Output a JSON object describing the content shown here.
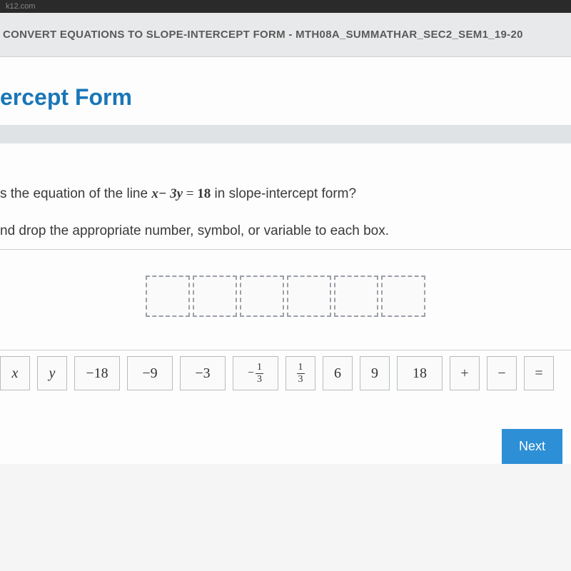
{
  "browser": {
    "url_fragment": "k12.com"
  },
  "header": {
    "breadcrumb": "CONVERT EQUATIONS TO SLOPE-INTERCEPT FORM - MTH08A_SUMMATHAR_SEC2_SEM1_19-20"
  },
  "page": {
    "title_fragment": "ercept Form",
    "question_prefix": "s the equation of the line ",
    "equation_lhs": "x− 3y",
    "equation_eq": " = ",
    "equation_rhs": "18",
    "question_suffix": " in slope-intercept form?",
    "instruction": "nd drop the appropriate number, symbol, or variable to each box."
  },
  "dropzone": {
    "slot_count": 6
  },
  "tiles": [
    {
      "id": "x",
      "label": "x",
      "type": "var"
    },
    {
      "id": "y",
      "label": "y",
      "type": "var"
    },
    {
      "id": "-18",
      "label": "−18",
      "type": "num",
      "wide": true
    },
    {
      "id": "-9",
      "label": "−9",
      "type": "num",
      "wide": true
    },
    {
      "id": "-3",
      "label": "−3",
      "type": "num",
      "wide": true
    },
    {
      "id": "-1/3",
      "label_neg": "−",
      "label_num": "1",
      "label_den": "3",
      "type": "negfrac",
      "wide": true
    },
    {
      "id": "1/3",
      "label_num": "1",
      "label_den": "3",
      "type": "frac"
    },
    {
      "id": "6",
      "label": "6",
      "type": "num"
    },
    {
      "id": "9",
      "label": "9",
      "type": "num"
    },
    {
      "id": "18",
      "label": "18",
      "type": "num",
      "wide": true
    },
    {
      "id": "plus",
      "label": "+",
      "type": "op"
    },
    {
      "id": "minus",
      "label": "−",
      "type": "op"
    },
    {
      "id": "equals",
      "label": "=",
      "type": "op"
    }
  ],
  "nav": {
    "next": "Next"
  }
}
